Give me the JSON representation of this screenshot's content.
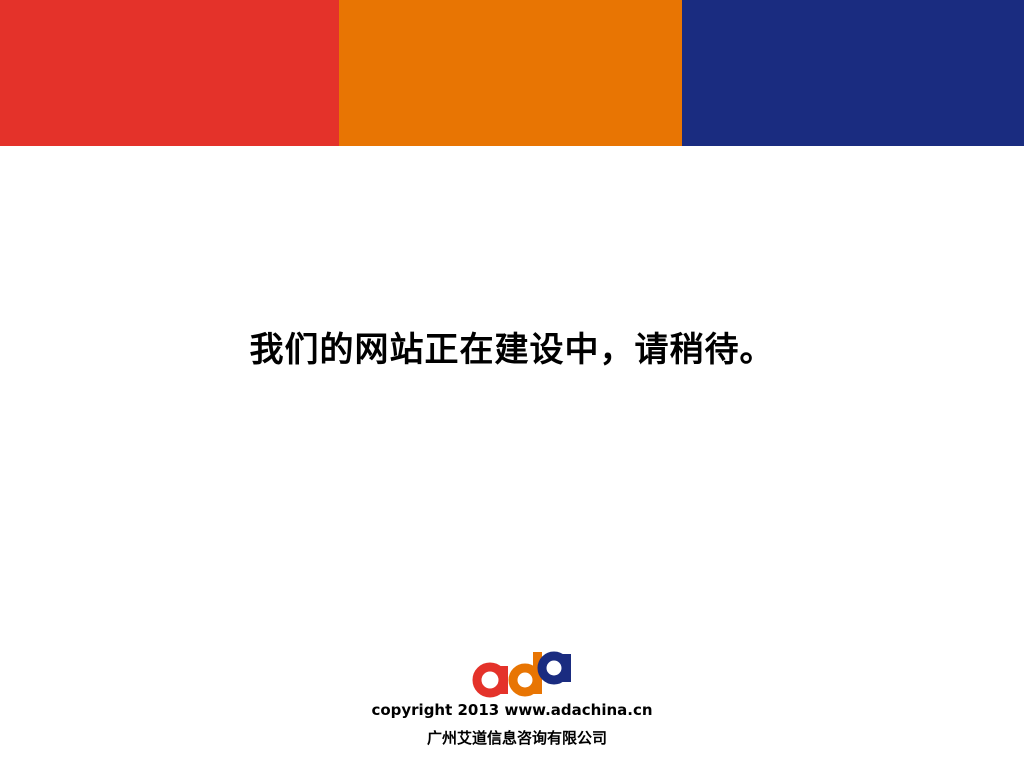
{
  "header": {
    "color_blocks": [
      {
        "name": "red",
        "color": "#e4322a"
      },
      {
        "name": "orange",
        "color": "#e87503"
      },
      {
        "name": "blue",
        "color": "#1a2c80"
      }
    ]
  },
  "main": {
    "message": "我们的网站正在建设中，请稍待。"
  },
  "footer": {
    "logo": {
      "letters": [
        "a",
        "d",
        "a"
      ],
      "colors": [
        "#e4322a",
        "#e87503",
        "#1a2c80"
      ]
    },
    "copyright": "copyright 2013 www.adachina.cn",
    "company": "广州艾道信息咨询有限公司"
  }
}
